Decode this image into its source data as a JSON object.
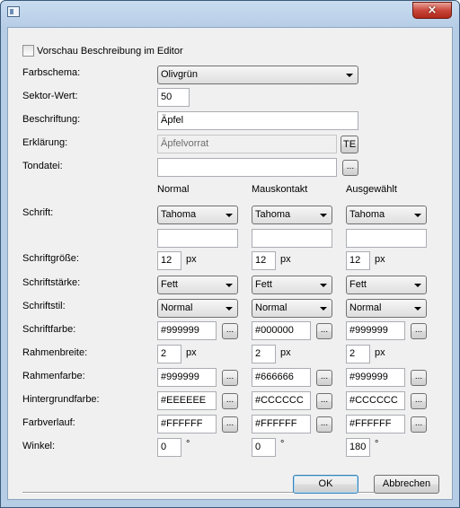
{
  "editor_preview_label": "Vorschau Beschreibung im Editor",
  "labels": {
    "color_scheme": "Farbschema:",
    "sector_value": "Sektor-Wert:",
    "caption": "Beschriftung:",
    "explanation": "Erklärung:",
    "sound_file": "Tondatei:",
    "font": "Schrift:",
    "font_size": "Schriftgröße:",
    "font_weight": "Schriftstärke:",
    "font_style": "Schriftstil:",
    "font_color": "Schriftfarbe:",
    "border_width": "Rahmenbreite:",
    "border_color": "Rahmenfarbe:",
    "background_color": "Hintergrundfarbe:",
    "gradient": "Farbverlauf:",
    "angle": "Winkel:"
  },
  "fields": {
    "color_scheme": "Olivgrün",
    "sector_value": "50",
    "caption": "Äpfel",
    "explanation": "Äpfelvorrat",
    "sound_file": "",
    "te_button": "TE",
    "browse": "..."
  },
  "columns": {
    "normal": {
      "header": "Normal",
      "font": "Tahoma",
      "font_extra": "",
      "size": "12",
      "weight": "Fett",
      "style": "Normal",
      "font_color": "#999999",
      "border_width": "2",
      "border_color": "#999999",
      "background": "#EEEEEE",
      "gradient": "#FFFFFF",
      "angle": "0"
    },
    "hover": {
      "header": "Mauskontakt",
      "font": "Tahoma",
      "font_extra": "",
      "size": "12",
      "weight": "Fett",
      "style": "Normal",
      "font_color": "#000000",
      "border_width": "2",
      "border_color": "#666666",
      "background": "#CCCCCC",
      "gradient": "#FFFFFF",
      "angle": "0"
    },
    "selected": {
      "header": "Ausgewählt",
      "font": "Tahoma",
      "font_extra": "",
      "size": "12",
      "weight": "Fett",
      "style": "Normal",
      "font_color": "#999999",
      "border_width": "2",
      "border_color": "#999999",
      "background": "#CCCCCC",
      "gradient": "#FFFFFF",
      "angle": "180"
    }
  },
  "units": {
    "px": "px",
    "degree": "°"
  },
  "buttons": {
    "ok": "OK",
    "cancel": "Abbrechen",
    "close": "×"
  },
  "colors": {
    "titlebar": "#b6cde6",
    "close": "#c9473a",
    "dialog_bg": "#f0f0f0"
  }
}
